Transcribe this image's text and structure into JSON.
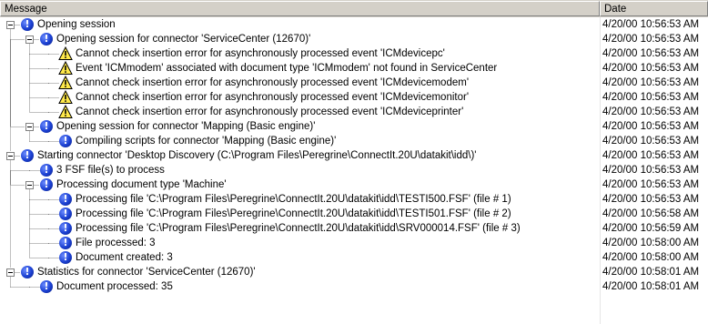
{
  "columns": {
    "message": "Message",
    "date": "Date"
  },
  "rows": [
    {
      "level": 0,
      "expander": true,
      "icon": "info",
      "message": "Opening session",
      "date": "4/20/00 10:56:53 AM"
    },
    {
      "level": 1,
      "expander": true,
      "icon": "info",
      "message": "Opening session for connector 'ServiceCenter (12670)'",
      "date": "4/20/00 10:56:53 AM"
    },
    {
      "level": 2,
      "expander": false,
      "icon": "warning",
      "message": "Cannot check insertion error for asynchronously processed event 'ICMdevicepc'",
      "date": "4/20/00 10:56:53 AM"
    },
    {
      "level": 2,
      "expander": false,
      "icon": "warning",
      "message": "Event 'ICMmodem' associated with document type 'ICMmodem' not found in ServiceCenter",
      "date": "4/20/00 10:56:53 AM"
    },
    {
      "level": 2,
      "expander": false,
      "icon": "warning",
      "message": "Cannot check insertion error for asynchronously processed event 'ICMdevicemodem'",
      "date": "4/20/00 10:56:53 AM"
    },
    {
      "level": 2,
      "expander": false,
      "icon": "warning",
      "message": "Cannot check insertion error for asynchronously processed event 'ICMdevicemonitor'",
      "date": "4/20/00 10:56:53 AM"
    },
    {
      "level": 2,
      "expander": false,
      "icon": "warning",
      "message": "Cannot check insertion error for asynchronously processed event 'ICMdeviceprinter'",
      "date": "4/20/00 10:56:53 AM"
    },
    {
      "level": 1,
      "expander": true,
      "icon": "info",
      "message": "Opening session for connector 'Mapping (Basic engine)'",
      "date": "4/20/00 10:56:53 AM"
    },
    {
      "level": 2,
      "expander": false,
      "icon": "info",
      "message": "Compiling scripts for connector 'Mapping (Basic engine)'",
      "date": "4/20/00 10:56:53 AM"
    },
    {
      "level": 0,
      "expander": true,
      "icon": "info",
      "message": "Starting connector 'Desktop Discovery (C:\\Program Files\\Peregrine\\ConnectIt.20U\\datakit\\idd\\)'",
      "date": "4/20/00 10:56:53 AM"
    },
    {
      "level": 1,
      "expander": false,
      "icon": "info",
      "message": "3 FSF file(s) to process",
      "date": "4/20/00 10:56:53 AM"
    },
    {
      "level": 1,
      "expander": true,
      "icon": "info",
      "message": "Processing document type 'Machine'",
      "date": "4/20/00 10:56:53 AM"
    },
    {
      "level": 2,
      "expander": false,
      "icon": "info",
      "message": "Processing file 'C:\\Program Files\\Peregrine\\ConnectIt.20U\\datakit\\idd\\TESTI500.FSF' (file # 1)",
      "date": "4/20/00 10:56:53 AM"
    },
    {
      "level": 2,
      "expander": false,
      "icon": "info",
      "message": "Processing file 'C:\\Program Files\\Peregrine\\ConnectIt.20U\\datakit\\idd\\TESTI501.FSF' (file # 2)",
      "date": "4/20/00 10:56:58 AM"
    },
    {
      "level": 2,
      "expander": false,
      "icon": "info",
      "message": "Processing file 'C:\\Program Files\\Peregrine\\ConnectIt.20U\\datakit\\idd\\SRV000014.FSF' (file # 3)",
      "date": "4/20/00 10:56:59 AM"
    },
    {
      "level": 2,
      "expander": false,
      "icon": "info",
      "message": "File processed: 3",
      "date": "4/20/00 10:58:00 AM"
    },
    {
      "level": 2,
      "expander": false,
      "icon": "info",
      "message": "Document created: 3",
      "date": "4/20/00 10:58:00 AM"
    },
    {
      "level": 0,
      "expander": true,
      "icon": "info",
      "message": "Statistics for connector 'ServiceCenter (12670)'",
      "date": "4/20/00 10:58:01 AM"
    },
    {
      "level": 1,
      "expander": false,
      "icon": "info",
      "message": "Document processed: 35",
      "date": "4/20/00 10:58:01 AM"
    }
  ]
}
